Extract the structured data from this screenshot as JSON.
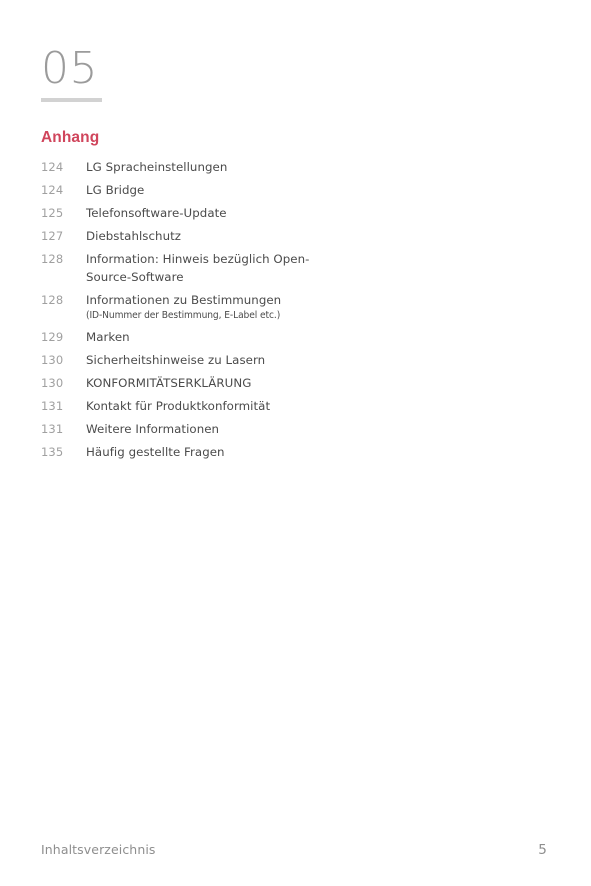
{
  "chapter": {
    "number": "05",
    "section_heading": "Anhang",
    "heading_color": "#D0455C",
    "number_color": "#9B9B9B",
    "rule_color": "#D2D2D2"
  },
  "toc": {
    "entries": [
      {
        "page": "124",
        "title": "LG Spracheinstellungen",
        "sub": ""
      },
      {
        "page": "124",
        "title": "LG Bridge",
        "sub": ""
      },
      {
        "page": "125",
        "title": "Telefonsoftware-Update",
        "sub": ""
      },
      {
        "page": "127",
        "title": "Diebstahlschutz",
        "sub": ""
      },
      {
        "page": "128",
        "title": "Information: Hinweis bezüglich Open-Source-Software",
        "sub": ""
      },
      {
        "page": "128",
        "title": "Informationen zu Bestimmungen",
        "sub": "(ID-Nummer der Bestimmung, E-Label etc.)"
      },
      {
        "page": "129",
        "title": "Marken",
        "sub": ""
      },
      {
        "page": "130",
        "title": "Sicherheitshinweise zu Lasern",
        "sub": ""
      },
      {
        "page": "130",
        "title": "KONFORMITÄTSERKLÄRUNG",
        "sub": ""
      },
      {
        "page": "131",
        "title": "Kontakt für Produktkonformität",
        "sub": ""
      },
      {
        "page": "131",
        "title": "Weitere Informationen",
        "sub": ""
      },
      {
        "page": "135",
        "title": "Häufig gestellte Fragen",
        "sub": ""
      }
    ]
  },
  "footer": {
    "label": "Inhaltsverzeichnis",
    "page_number": "5"
  }
}
